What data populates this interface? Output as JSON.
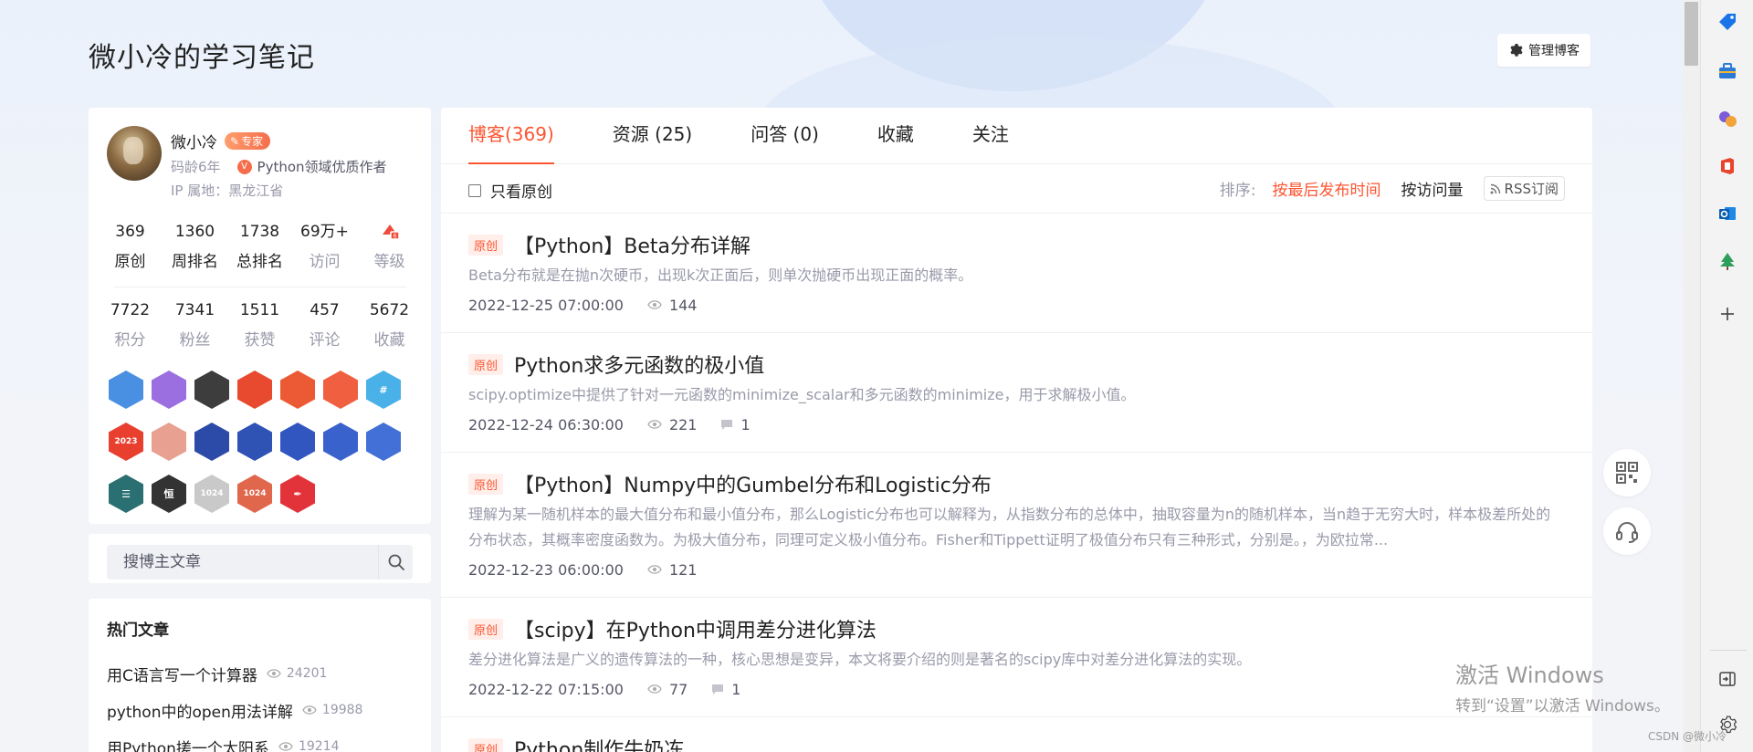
{
  "blog": {
    "title": "微小冷的学习笔记",
    "manage_label": "管理博客"
  },
  "profile": {
    "name": "微小冷",
    "expert_label": "专家",
    "code_age": "码龄6年",
    "author_title": "Python领域优质作者",
    "ip_location": "IP 属地：黑龙江省",
    "stats_row1": [
      {
        "value": "369",
        "label": "原创"
      },
      {
        "value": "1360",
        "label": "周排名"
      },
      {
        "value": "1738",
        "label": "总排名"
      },
      {
        "value": "69万+",
        "label": "访问"
      },
      {
        "value": "",
        "label": "等级"
      }
    ],
    "stats_row2": [
      {
        "value": "7722",
        "label": "积分"
      },
      {
        "value": "7341",
        "label": "粉丝"
      },
      {
        "value": "1511",
        "label": "获赞"
      },
      {
        "value": "457",
        "label": "评论"
      },
      {
        "value": "5672",
        "label": "收藏"
      }
    ],
    "badges": [
      {
        "icon": "planet-blue-badge-icon",
        "color": "#4a90e2",
        "text": ""
      },
      {
        "icon": "planet-purple-badge-icon",
        "color": "#9b6fe0",
        "text": ""
      },
      {
        "icon": "lightning-dark-badge-icon",
        "color": "#3d3d3d",
        "text": ""
      },
      {
        "icon": "red-award-badge-icon",
        "color": "#e84a2f",
        "text": ""
      },
      {
        "icon": "red-award-2-badge-icon",
        "color": "#ec5a35",
        "text": ""
      },
      {
        "icon": "red-award-3-badge-icon",
        "color": "#f06040",
        "text": ""
      },
      {
        "icon": "hash-blue-badge-icon",
        "color": "#4ab0e8",
        "text": "#"
      },
      {
        "icon": "red-2023-badge-icon",
        "color": "#e83f2f",
        "text": "2023"
      },
      {
        "icon": "monkey-badge-icon",
        "color": "#e8a090",
        "text": ""
      },
      {
        "icon": "rocket-1-badge-icon",
        "color": "#2c4aa8",
        "text": ""
      },
      {
        "icon": "rocket-2-badge-icon",
        "color": "#2f52b5",
        "text": ""
      },
      {
        "icon": "rocket-3-badge-icon",
        "color": "#3256c0",
        "text": ""
      },
      {
        "icon": "rocket-4-badge-icon",
        "color": "#3a62cc",
        "text": ""
      },
      {
        "icon": "rocket-5-badge-icon",
        "color": "#4270d6",
        "text": ""
      },
      {
        "icon": "list-teal-badge-icon",
        "color": "#2a6f72",
        "text": "☰"
      },
      {
        "icon": "heng-dark-badge-icon",
        "color": "#333333",
        "text": "恒"
      },
      {
        "icon": "1024-badge-icon",
        "color": "#c9c9c9",
        "text": "1024"
      },
      {
        "icon": "1024-red-badge-icon",
        "color": "#e0664c",
        "text": "1024"
      },
      {
        "icon": "pen-red-badge-icon",
        "color": "#e2333a",
        "text": "✒"
      }
    ]
  },
  "search": {
    "placeholder": "搜博主文章"
  },
  "hot": {
    "title": "热门文章",
    "items": [
      {
        "title": "用C语言写一个计算器",
        "views": "24201"
      },
      {
        "title": "python中的open用法详解",
        "views": "19988"
      },
      {
        "title": "用Python搓一个太阳系",
        "views": "19214"
      }
    ]
  },
  "tabs": [
    {
      "label": "博客(369)",
      "active": true
    },
    {
      "label": "资源 (25)",
      "active": false
    },
    {
      "label": "问答 (0)",
      "active": false
    },
    {
      "label": "收藏",
      "active": false
    },
    {
      "label": "关注",
      "active": false
    }
  ],
  "filter": {
    "original_only": "只看原创",
    "sort_label": "排序:",
    "sort_latest": "按最后发布时间",
    "sort_views": "按访问量",
    "rss": "RSS订阅"
  },
  "articles": [
    {
      "tag": "原创",
      "title": "【Python】Beta分布详解",
      "desc": "Beta分布就是在抛n次硬币，出现k次正面后，则单次抛硬币出现正面的概率。",
      "date": "2022-12-25 07:00:00",
      "views": "144",
      "comments": ""
    },
    {
      "tag": "原创",
      "title": "Python求多元函数的极小值",
      "desc": "scipy.optimize中提供了针对一元函数的minimize_scalar和多元函数的minimize，用于求解极小值。",
      "date": "2022-12-24 06:30:00",
      "views": "221",
      "comments": "1"
    },
    {
      "tag": "原创",
      "title": "【Python】Numpy中的Gumbel分布和Logistic分布",
      "desc": "理解为某一随机样本的最大值分布和最小值分布，那么Logistic分布也可以解释为，从指数分布的总体中，抽取容量为n的随机样本，当n趋于无穷大时，样本极差所处的分布状态，其概率密度函数为。为极大值分布，同理可定义极小值分布。Fisher和Tippett证明了极值分布只有三种形式，分别是。，为欧拉常...",
      "date": "2022-12-23 06:00:00",
      "views": "121",
      "comments": ""
    },
    {
      "tag": "原创",
      "title": "【scipy】在Python中调用差分进化算法",
      "desc": "差分进化算法是广义的遗传算法的一种，核心思想是变异，本文将要介绍的则是著名的scipy库中对差分进化算法的实现。",
      "date": "2022-12-22 07:15:00",
      "views": "77",
      "comments": "1"
    },
    {
      "tag": "原创",
      "title": "Python制作牛奶冻",
      "desc": "",
      "date": "",
      "views": "",
      "comments": ""
    }
  ],
  "watermark": {
    "line1": "激活 Windows",
    "line2": "转到“设置”以激活 Windows。"
  },
  "csdn_mark": "CSDN @微小冷",
  "colors": {
    "accent": "#fc5531",
    "muted": "#999aaa"
  }
}
